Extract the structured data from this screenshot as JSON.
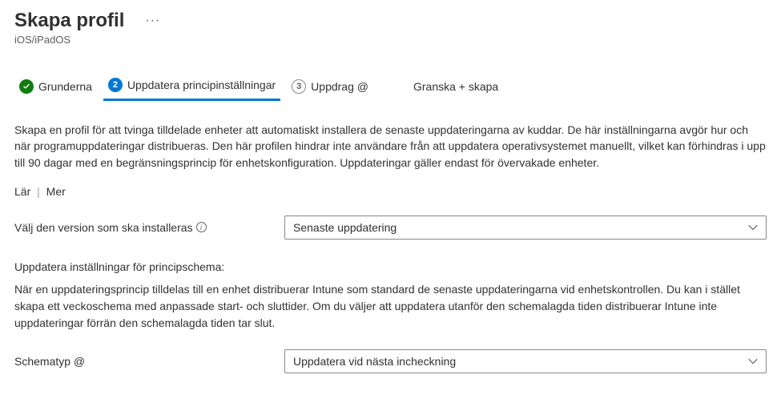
{
  "header": {
    "title": "Skapa profil",
    "subtitle": "iOS/iPadOS",
    "more": "···"
  },
  "wizard": {
    "step1": {
      "label": "Grunderna"
    },
    "step2": {
      "label": "Uppdatera principinställningar",
      "num": "2"
    },
    "step3": {
      "label": "Uppdrag @",
      "num": "3"
    },
    "step4": {
      "label": "Granska + skapa"
    }
  },
  "description": "Skapa en profil för att tvinga tilldelade enheter att automatiskt installera de senaste uppdateringarna av kuddar. De här inställningarna avgör hur och när programuppdateringar distribueras. Den här profilen hindrar inte användare från att uppdatera operativsystemet manuellt, vilket kan förhindras i upp till 90 dagar med en begränsningsprincip för enhetskonfiguration. Uppdateringar gäller endast för övervakade enheter.",
  "learn": {
    "left": "Lär",
    "right": "Mer"
  },
  "form": {
    "version_label": "Välj den version som ska installeras",
    "version_value": "Senaste uppdatering",
    "schedule_heading": "Uppdatera inställningar för principschema:",
    "schedule_desc": "När en uppdateringsprincip tilldelas till en enhet distribuerar Intune som standard de senaste uppdateringarna vid enhetskontrollen. Du kan i stället skapa ett veckoschema med anpassade start- och sluttider. Om du väljer att uppdatera utanför den schemalagda tiden distribuerar Intune inte uppdateringar förrän den schemalagda tiden tar slut.",
    "schedule_type_label": "Schematyp @",
    "schedule_type_value": "Uppdatera vid nästa incheckning"
  }
}
